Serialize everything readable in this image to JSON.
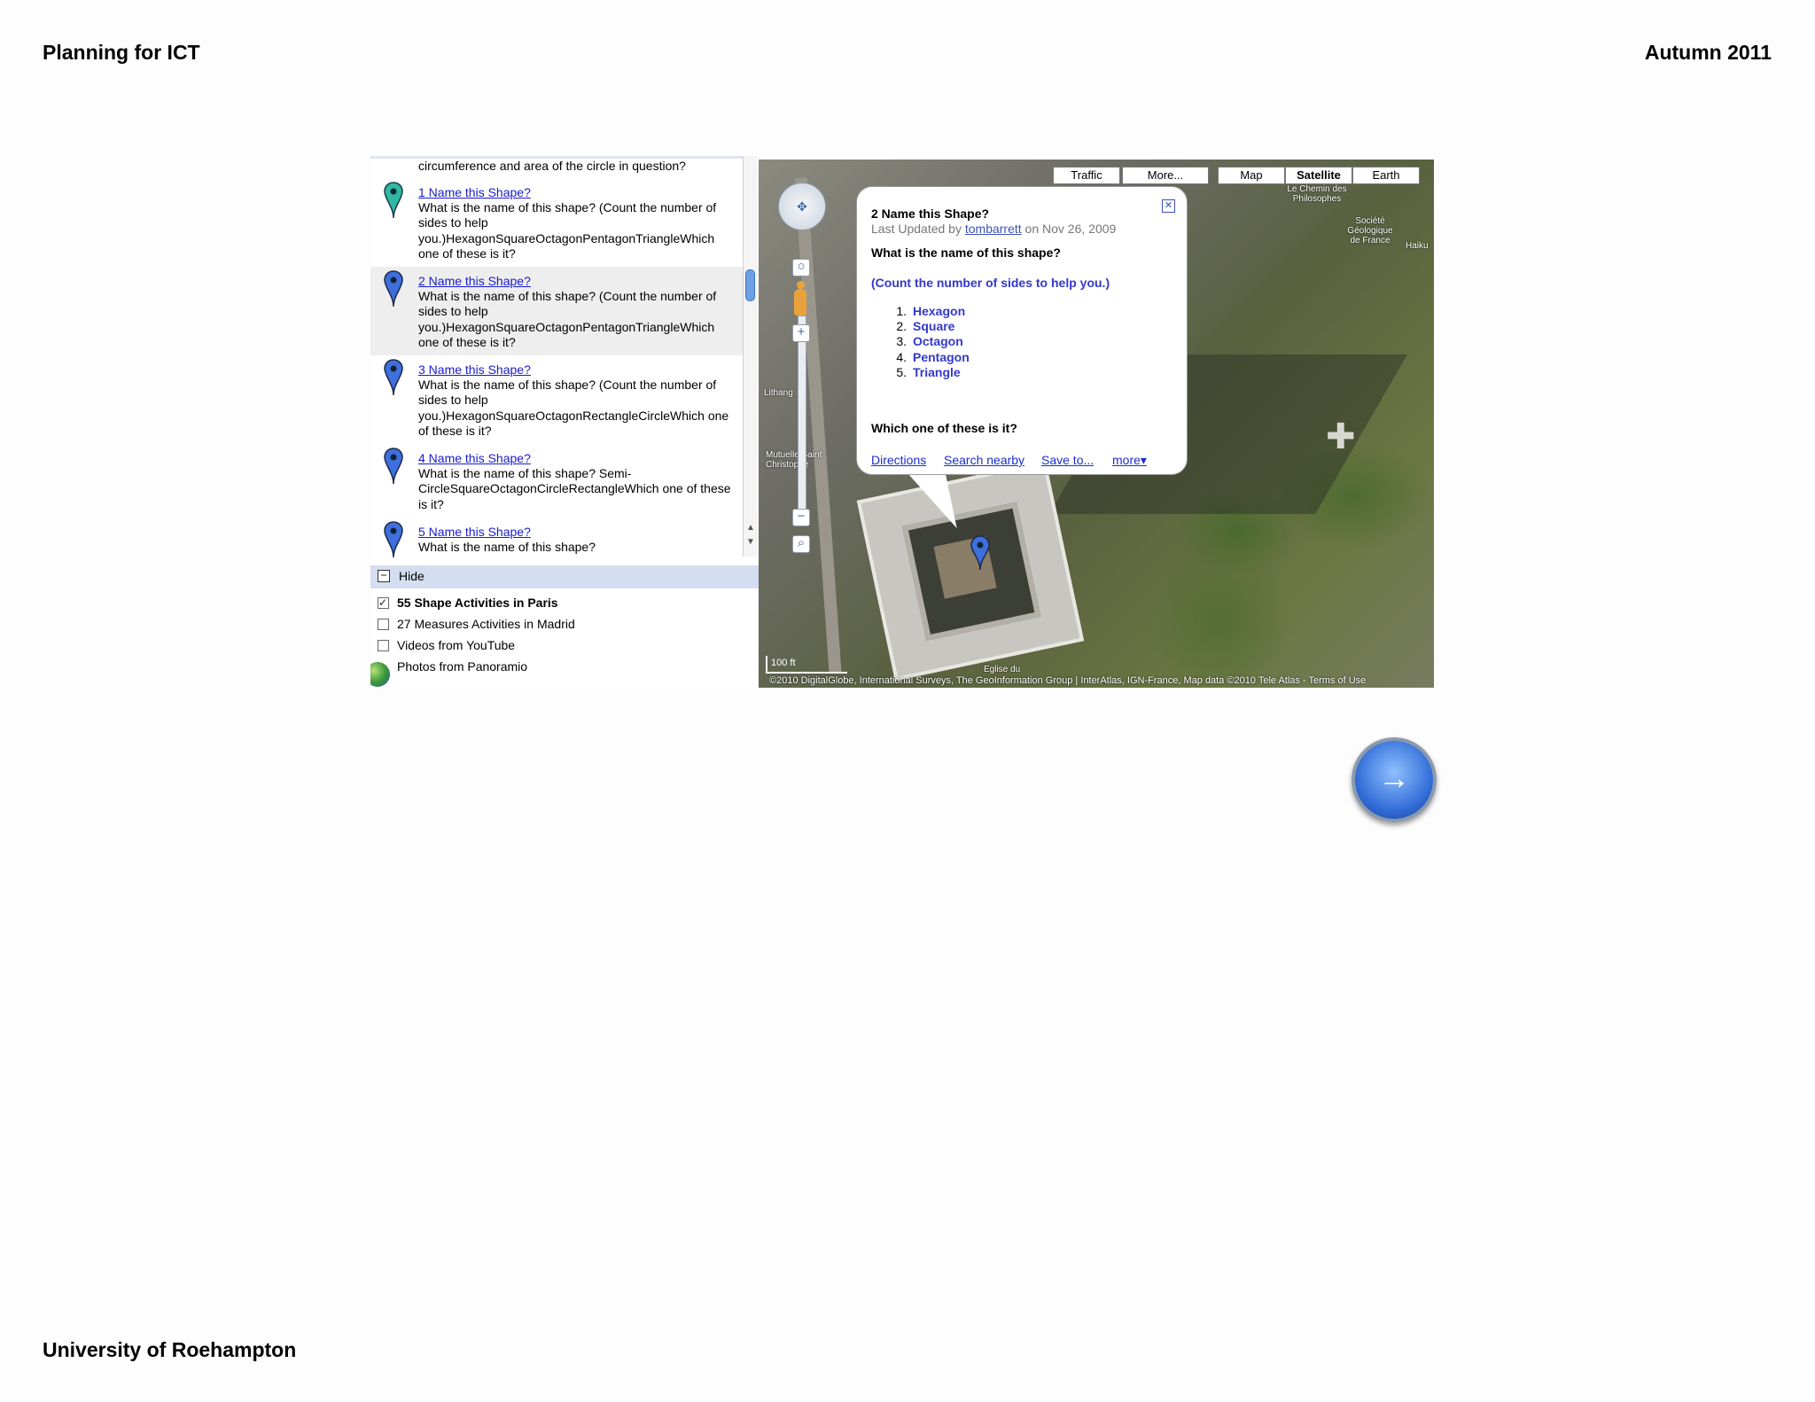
{
  "header": {
    "left": "Planning for ICT",
    "right": "Autumn 2011"
  },
  "footer": "University of Roehampton",
  "results": {
    "cut_off_text": "circumference and area of the circle in question?",
    "items": [
      {
        "title": "1 Name this Shape?",
        "description": "What is the name of this shape? (Count the number of sides to help you.)HexagonSquareOctagonPentagonTriangleWhich one of these is it?",
        "pin_color": "#2fb9a3"
      },
      {
        "title": "2 Name this Shape?",
        "description": "What is the name of this shape? (Count the number of sides to help you.)HexagonSquareOctagonPentagonTriangleWhich one of these is it?",
        "pin_color": "#3f6fdc"
      },
      {
        "title": "3 Name this Shape?",
        "description": "What is the name of this shape? (Count the number of sides to help you.)HexagonSquareOctagonRectangleCircleWhich one of these is it?",
        "pin_color": "#3f6fdc"
      },
      {
        "title": "4 Name this Shape?",
        "description": "What is the name of this shape? Semi-CircleSquareOctagonCircleRectangleWhich one of these is it?",
        "pin_color": "#3f6fdc"
      },
      {
        "title": "5 Name this Shape?",
        "description": "What is the name of this shape?",
        "pin_color": "#3f6fdc"
      }
    ]
  },
  "layers": {
    "hide_label": "Hide",
    "items": [
      {
        "label": "55 Shape Activities in Paris",
        "checked": "✓"
      },
      {
        "label": "27 Measures Activities in Madrid",
        "checked": ""
      },
      {
        "label": "Videos from YouTube",
        "checked": ""
      },
      {
        "label": "Photos from Panoramio",
        "checked": ""
      }
    ]
  },
  "map": {
    "buttons": {
      "traffic": "Traffic",
      "more": "More...",
      "map": "Map",
      "satellite": "Satellite",
      "earth": "Earth"
    },
    "scale": "100 ft",
    "attribution": "©2010 DigitalGlobe, International Surveys, The GeoInformation Group | InterAtlas, IGN-France, Map data ©2010 Tele Atlas - Terms of Use",
    "labels": [
      "Le Chemin des Philosophes",
      "Société Géologique de France",
      "Haiku",
      "Mutuelle Saint Christophe",
      "Lithang",
      "Eglise du"
    ]
  },
  "infowindow": {
    "title": "2 Name this Shape?",
    "updated_prefix": "Last Updated by ",
    "updated_user": "tombarrett",
    "updated_suffix": " on Nov 26, 2009",
    "question": "What is the name of this shape?",
    "hint": "(Count the number of sides to help you.)",
    "options": [
      "Hexagon",
      "Square",
      "Octagon",
      "Pentagon",
      "Triangle"
    ],
    "which": "Which one of these is it?",
    "links": {
      "directions": "Directions",
      "search_nearby": "Search nearby",
      "save_to": "Save to...",
      "more": "more▾"
    }
  }
}
